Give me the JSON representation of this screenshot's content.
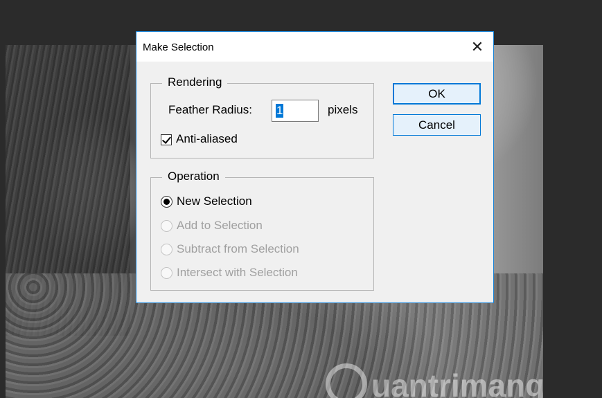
{
  "dialog": {
    "title": "Make Selection",
    "close_glyph": "✕",
    "rendering": {
      "legend": "Rendering",
      "feather_label": "Feather Radius:",
      "feather_value": "1",
      "feather_unit": "pixels",
      "anti_aliased_label": "Anti-aliased",
      "anti_aliased_checked": true
    },
    "operation": {
      "legend": "Operation",
      "options": [
        {
          "label": "New Selection",
          "selected": true,
          "enabled": true
        },
        {
          "label": "Add to Selection",
          "selected": false,
          "enabled": false
        },
        {
          "label": "Subtract from Selection",
          "selected": false,
          "enabled": false
        },
        {
          "label": "Intersect with Selection",
          "selected": false,
          "enabled": false
        }
      ]
    },
    "buttons": {
      "ok": "OK",
      "cancel": "Cancel"
    }
  },
  "watermark": {
    "text": "uantrimang"
  },
  "colors": {
    "accent": "#0078d7",
    "dialog_border": "#1883d7",
    "background": "#2b2b2b"
  }
}
